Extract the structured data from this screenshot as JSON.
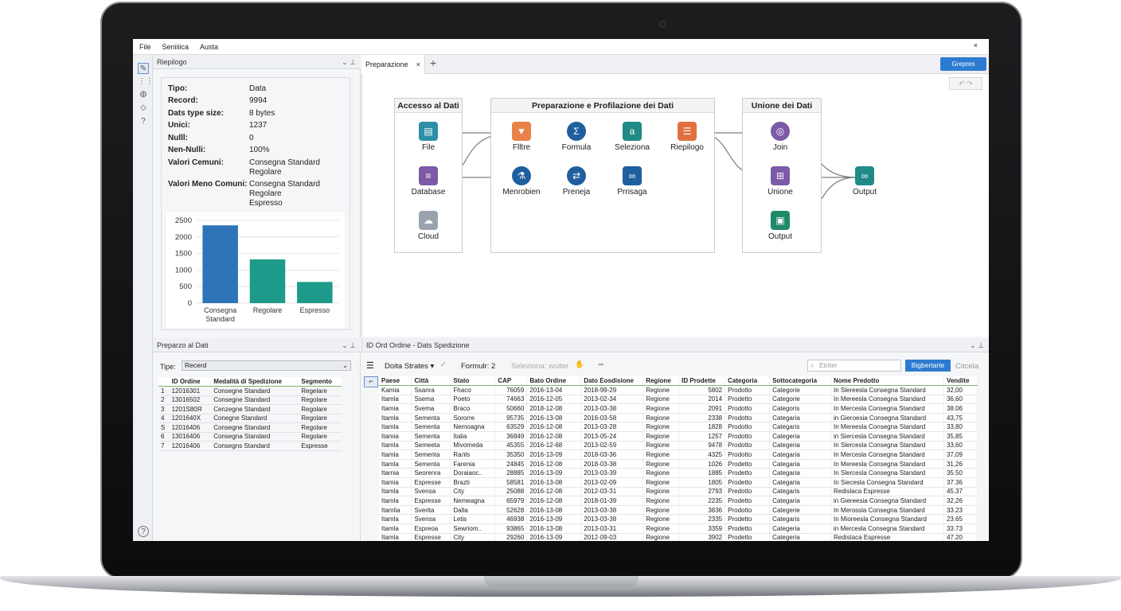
{
  "menu": {
    "items": [
      "File",
      "Seniiiica",
      "Austa"
    ],
    "close": "×"
  },
  "left_panel": {
    "title": "Riepilogo",
    "summary": [
      {
        "label": "Tipo:",
        "value": "Data"
      },
      {
        "label": "Record:",
        "value": "9994"
      },
      {
        "label": "Dats type size:",
        "value": "8 bytes"
      },
      {
        "label": "Unici:",
        "value": "1237"
      },
      {
        "label": "Nulll:",
        "value": "0"
      },
      {
        "label": "Nen-Nulli:",
        "value": "100%"
      },
      {
        "label": "Valori Cemuni:",
        "value": "Consegna Standard\nRegolare"
      },
      {
        "label": "Valori Meno Comuni:",
        "value": "Consegna Standard\nRegolare\nEspresso"
      }
    ]
  },
  "chart_data": {
    "type": "bar",
    "categories": [
      "Consegna Standard",
      "Regolare",
      "Espresso"
    ],
    "values": [
      2350,
      1320,
      640
    ],
    "ylim": [
      0,
      2500
    ],
    "yticks": [
      0,
      500,
      1000,
      1500,
      2000,
      2500
    ],
    "colors": [
      "#2e74b8",
      "#1e9a8a",
      "#1e9a8a"
    ],
    "grid": true
  },
  "bottom_left": {
    "title": "Preparzo al  Dati",
    "tipo_label": "Tipe:",
    "tipo_value": "Recerd",
    "columns": [
      "",
      "ID Ordine",
      "Medalità di Spedizione",
      "Segmento"
    ],
    "rows": [
      [
        "1",
        "12016301",
        "Consegne Standard",
        "Regelare"
      ],
      [
        "2",
        "13016502",
        "Consegne Standard",
        "Regolare"
      ],
      [
        "3",
        "1201S80Я",
        "Cenzegne Standard",
        "Regolare"
      ],
      [
        "4",
        "1201640X",
        "Conegne Standard",
        "Regolare"
      ],
      [
        "S",
        "12016406",
        "Consegne Standard",
        "Regolare"
      ],
      [
        "6",
        "13016406",
        "Consegna Standard",
        "Regolare"
      ],
      [
        "7",
        "12016406",
        "Consegns Standard",
        "Espresse"
      ]
    ]
  },
  "tabs": {
    "active": "Preparazione",
    "close": "×",
    "add": "+",
    "button": "Grepres"
  },
  "containers": [
    {
      "title": "Accesso al Dati",
      "tools": [
        "File",
        "Database",
        "Cloud"
      ]
    },
    {
      "title": "Preparazione e Profilazione dei Dati",
      "tools": [
        "Flltre",
        "Formula",
        "Seleziona",
        "Riepilogo",
        "Menrobien",
        "Preneja",
        "Prrisaga"
      ]
    },
    {
      "title": "Unione dei Dati",
      "tools": [
        "Join",
        "Unione",
        "Output"
      ]
    }
  ],
  "output_tool": "Output",
  "bottom_right": {
    "title": "ID Ord Ordine - Dats Spedizione",
    "toolbar": {
      "dropdown": "Doita Strates",
      "formula": "Formulr: 2",
      "seleziona": "Seleziona: wuiter",
      "search_placeholder": "Etriter",
      "btn": "Bigbertarte",
      "cancel": "Citcela"
    },
    "columns": [
      "Paese",
      "Città",
      "Stato",
      "CAP",
      "Bato Ordine",
      "Dato Eosdisione",
      "Regione",
      "ID Prodette",
      "Categoria",
      "Sottocategoria",
      "Nome Predotto",
      "Vendite"
    ],
    "rows": [
      [
        "Kamia",
        "Ssanra",
        "Fhaco",
        "76059",
        "2016-13-04",
        "2018-99-29",
        "Regione",
        "5802",
        "Prodotto",
        "Categorie",
        "In Slereesla Consegna Standard",
        "32,00"
      ],
      [
        "Itamla",
        "Ssema",
        "Poeto",
        "74663",
        "2016-12-05",
        "2013-02-34",
        "Regione",
        "2014",
        "Prodetto",
        "Categorie",
        "In Mereesla Consegna Standard",
        "36,60"
      ],
      [
        "Itamia",
        "Svema",
        "Braco",
        "50660",
        "2018-12-08",
        "2013-03-38",
        "Regione",
        "2091",
        "Prodotto",
        "Categoris",
        "In Mercesla Consegna Standard",
        "38.06"
      ],
      [
        "Itamla",
        "Sementa",
        "Sororre",
        "95735",
        "2016-13-08",
        "2016-03-58",
        "Regione",
        "2338",
        "Prodotto",
        "Categaria",
        "in Gieroesia Consegna Standard",
        "43,75"
      ],
      [
        "Itamla",
        "Sementa",
        "Nemoagna",
        "63529",
        "2016-12-08",
        "2013-03-28",
        "Regione",
        "1828",
        "Prodotto",
        "Categaris",
        "In Mereesla Consegna Standard",
        "33,80"
      ],
      [
        "Itamia",
        "Sementa",
        "Italia",
        "36849",
        "2016-12-08",
        "2013-05-24",
        "Regione",
        "1257",
        "Prodotto",
        "Categeria",
        "in Siercesla Consegna Standard",
        "35,85"
      ],
      [
        "Itamla",
        "Semeeta",
        "Mivomeda",
        "45355",
        "2016-12-68",
        "2013-02-59",
        "Regione",
        "9478",
        "Prodotto",
        "Categeria",
        "In Slercesla Consegna Standard",
        "33,60"
      ],
      [
        "Itamla",
        "Sementa",
        "Rалls",
        "35350",
        "2016-13-09",
        "2018-03-36",
        "Regione",
        "4325",
        "Prodotto",
        "Categaria",
        "In Mercesla Consegna Standard",
        "37,09"
      ],
      [
        "Itamla",
        "Sementa",
        "Farenia",
        "24845",
        "2016-12-08",
        "2018-03-38",
        "Regione",
        "1026",
        "Prodetto",
        "Categaria",
        "In Mereesla Consegna Standard",
        "31,26"
      ],
      [
        "Itarnia",
        "Seorenra",
        "Doraiaoc..",
        "28885",
        "2016-13-09",
        "2013-03-39",
        "Regione",
        "1885",
        "Prodetto",
        "Categaria",
        "In Slercesla Consegna Standard",
        "35.50"
      ],
      [
        "Itamia",
        "Espresse",
        "Brazti",
        "58581",
        "2016-13-08",
        "2013-02-09",
        "Regione",
        "1805",
        "Prodetto",
        "Categaria",
        "In Siecesla Consegna Standard",
        "37.36"
      ],
      [
        "Itamla",
        "Svensa",
        "City",
        "25088",
        "2016-12-08",
        "2012-03-31",
        "Regione",
        "2793",
        "Predotto",
        "Categaris",
        "Redislaca Espresse",
        "45.37"
      ],
      [
        "Itamla",
        "Espresse",
        "Nemeagna",
        "65979",
        "2016-12-08",
        "2018-01-39",
        "Regione",
        "2235",
        "Prodetto",
        "Categaria",
        "in Giereesia Consegna Standard",
        "32,26"
      ],
      [
        "Itamlia",
        "Sverita",
        "Dalla",
        "52628",
        "2016-13-08",
        "2013-03-38",
        "Regione",
        "3836",
        "Prodotto",
        "Categerie",
        "In Merossla Consegna Standard",
        "33.23"
      ],
      [
        "Itamla",
        "Svensa",
        "Letis",
        "46938",
        "2016-13-09",
        "2013-03-38",
        "Regione",
        "2335",
        "Prodetto",
        "Categaris",
        "In Mioreesla Consegna Standard",
        "23.65"
      ],
      [
        "Itamla",
        "Espreoa",
        "Sewriom..",
        "93865",
        "2016-13-08",
        "2013-03-31",
        "Regione",
        "3359",
        "Prodetto",
        "Categeria",
        "in Mercesla Consegna Standard",
        "33.73"
      ],
      [
        "Itamla",
        "Espresse",
        "City",
        "29260",
        "2016-13-09",
        "2012-09-03",
        "Regione",
        "3902",
        "Prodetto",
        "Categeria",
        "Redistaca Espresse",
        "47.20"
      ]
    ]
  }
}
